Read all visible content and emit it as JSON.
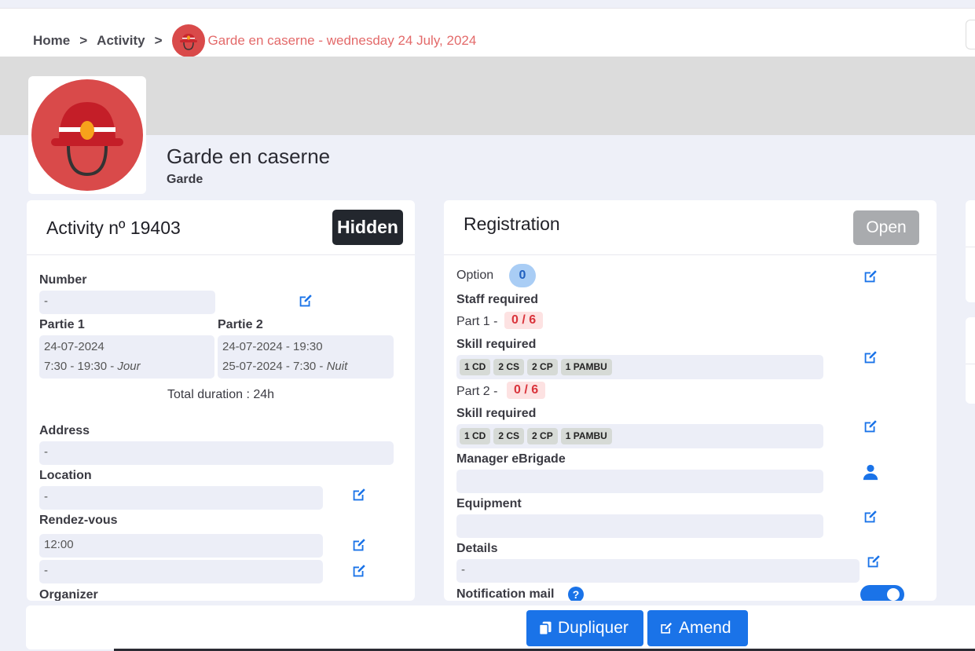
{
  "breadcrumb": {
    "home": "Home",
    "activity": "Activity",
    "current": "Garde en caserne - wednesday 24 July, 2024"
  },
  "header": {
    "title": "Garde en caserne",
    "subtitle": "Garde"
  },
  "activity_card": {
    "title": "Activity nº 19403",
    "status_badge": "Hidden",
    "number_label": "Number",
    "number_value": "-",
    "partie1_label": "Partie 1",
    "partie1_date": "24-07-2024",
    "partie1_time": "7:30 - 19:30 - ",
    "partie1_shift": "Jour",
    "partie2_label": "Partie 2",
    "partie2_date": "24-07-2024 - 19:30",
    "partie2_time": "25-07-2024 - 7:30 - ",
    "partie2_shift": "Nuit",
    "total_duration": "Total duration : 24h",
    "address_label": "Address",
    "address_value": "-",
    "location_label": "Location",
    "location_value": "-",
    "rendezvous_label": "Rendez-vous",
    "rendezvous_time": "12:00",
    "rendezvous_place": "-",
    "organizer_label": "Organizer"
  },
  "registration_card": {
    "title": "Registration",
    "status_badge": "Open",
    "option_label": "Option",
    "option_count": "0",
    "staff_required_label": "Staff required",
    "part1_label": "Part 1 -",
    "part1_ratio": "0 / 6",
    "skill_required_label": "Skill required",
    "part1_skills": [
      "1 CD",
      "2 CS",
      "2 CP",
      "1 PAMBU"
    ],
    "part2_label": "Part 2 -",
    "part2_ratio": "0 / 6",
    "skill_required_label_2": "Skill required",
    "part2_skills": [
      "1 CD",
      "2 CS",
      "2 CP",
      "1 PAMBU"
    ],
    "manager_label": "Manager eBrigade",
    "manager_value": "",
    "equipment_label": "Equipment",
    "equipment_value": "",
    "details_label": "Details",
    "details_value": "-",
    "notification_label": "Notification mail",
    "notification_help": "?",
    "notification_enabled": true
  },
  "footer": {
    "duplicate_label": "Dupliquer",
    "amend_label": "Amend"
  },
  "colors": {
    "primary": "#1a73e8",
    "danger_text": "#d9333b",
    "helmet_red": "#d94a4a"
  }
}
